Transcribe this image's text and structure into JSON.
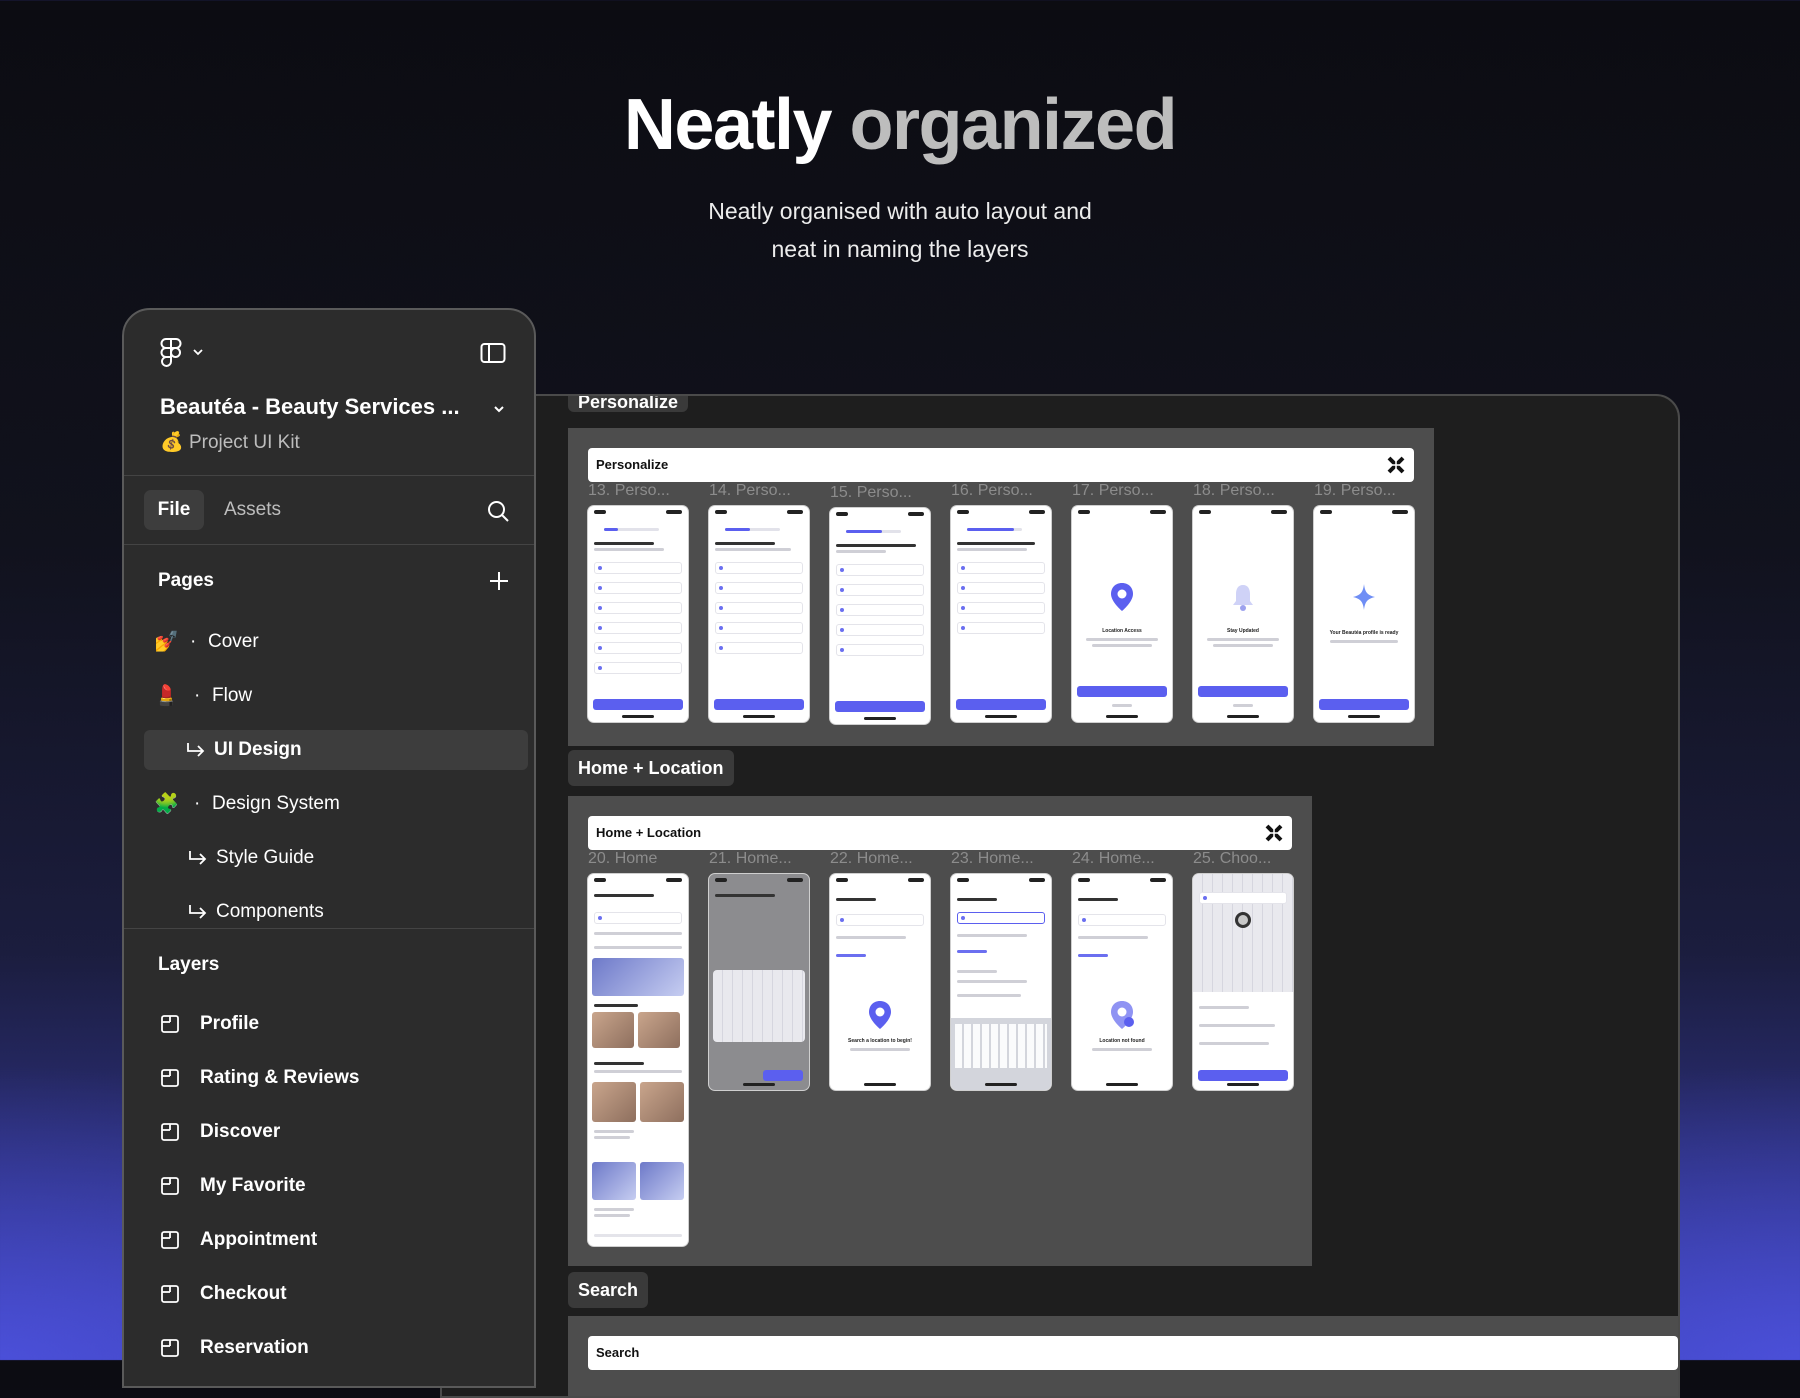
{
  "hero": {
    "title_word1": "Neatly",
    "title_word2": "organized",
    "subtitle_line1": "Neatly organised with auto layout and",
    "subtitle_line2": "neat in naming the layers"
  },
  "sidebar": {
    "project_title": "Beautéa - Beauty Services ...",
    "project_emoji": "💰",
    "project_subtitle": "Project UI Kit",
    "tabs": {
      "file": "File",
      "assets": "Assets"
    },
    "pages_heading": "Pages",
    "pages": [
      {
        "emoji": "💅",
        "dot": "·",
        "label": "Cover"
      },
      {
        "emoji": "💄",
        "dot": "·",
        "label": "Flow"
      },
      {
        "label": "UI Design"
      },
      {
        "emoji": "🧩",
        "dot": "·",
        "label": "Design System"
      },
      {
        "label": "Style Guide"
      },
      {
        "label": "Components"
      }
    ],
    "layers_heading": "Layers",
    "layers": [
      "Profile",
      "Rating & Reviews",
      "Discover",
      "My Favorite",
      "Appointment",
      "Checkout",
      "Reservation"
    ]
  },
  "canvas": {
    "top_tag": "Personalize",
    "personalize": {
      "header": "Personalize",
      "screens": [
        "13. Perso...",
        "14. Perso...",
        "15. Perso...",
        "16. Perso...",
        "17. Perso...",
        "18. Perso...",
        "19. Perso..."
      ],
      "texts": [
        "Location Access",
        "Stay Updated",
        "Your Beautéa profile is ready"
      ]
    },
    "home_tag": "Home + Location",
    "home": {
      "header": "Home + Location",
      "screens": [
        "20. Home",
        "21. Home...",
        "22. Home...",
        "23. Home...",
        "24. Home...",
        "25. Choo..."
      ],
      "texts": [
        "Search a location to begin!",
        "Location not found"
      ]
    },
    "search_tag": "Search",
    "search_header": "Search"
  },
  "colors": {
    "accent": "#5b5fef",
    "panel": "#2c2c2c",
    "canvas": "#1e1e1e"
  }
}
